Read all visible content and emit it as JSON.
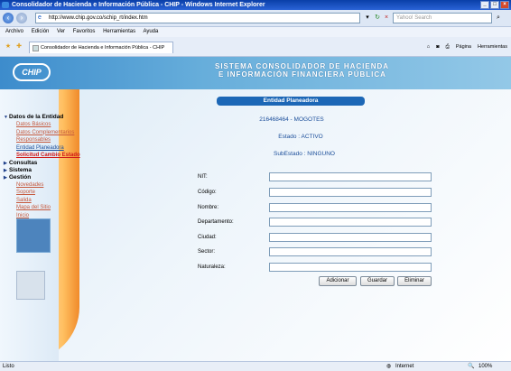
{
  "window": {
    "title": "Consolidador de Hacienda e Información Pública - CHIP - Windows Internet Explorer"
  },
  "toolbar": {
    "url": "http://www.chip.gov.co/schip_rt/index.htm",
    "search_placeholder": "Yahoo! Search"
  },
  "menubar": {
    "items": [
      "Archivo",
      "Edición",
      "Ver",
      "Favoritos",
      "Herramientas",
      "Ayuda"
    ]
  },
  "tabbar": {
    "tab_title": "Consolidador de Hacienda e Información Pública - CHIP",
    "page_label": "Página",
    "tools_label": "Herramientas"
  },
  "header": {
    "logo": "CHIP",
    "line1": "SISTEMA CONSOLIDADOR DE HACIENDA",
    "line2": "E INFORMACIÓN FINANCIERA PÚBLICA"
  },
  "sidebar": {
    "section1": "Datos de la Entidad",
    "section1_items": [
      "Datos Básicos",
      "Datos Complementarios",
      "Responsables",
      "Entidad Planeadora",
      "Solicitud Cambio Estado"
    ],
    "section2": "Consultas",
    "section3": "Sistema",
    "section4": "Gestión",
    "section4_items": [
      "Novedades",
      "Soporte",
      "Salida",
      "Mapa del Sitio",
      "Inicio"
    ]
  },
  "form": {
    "heading": "Entidad Planeadora",
    "entity": "216468464 - MOGOTES",
    "estado": "Estado : ACTIVO",
    "subestado": "SubEstado : NINGUNO",
    "fields": [
      "NIT:",
      "Código:",
      "Nombre:",
      "Departamento:",
      "Ciudad:",
      "Sector:",
      "Naturaleza:"
    ],
    "buttons": {
      "add": "Adicionar",
      "save": "Guardar",
      "delete": "Eliminar"
    }
  },
  "statusbar": {
    "left": "Listo",
    "zone": "Internet",
    "zoom": "100%"
  }
}
